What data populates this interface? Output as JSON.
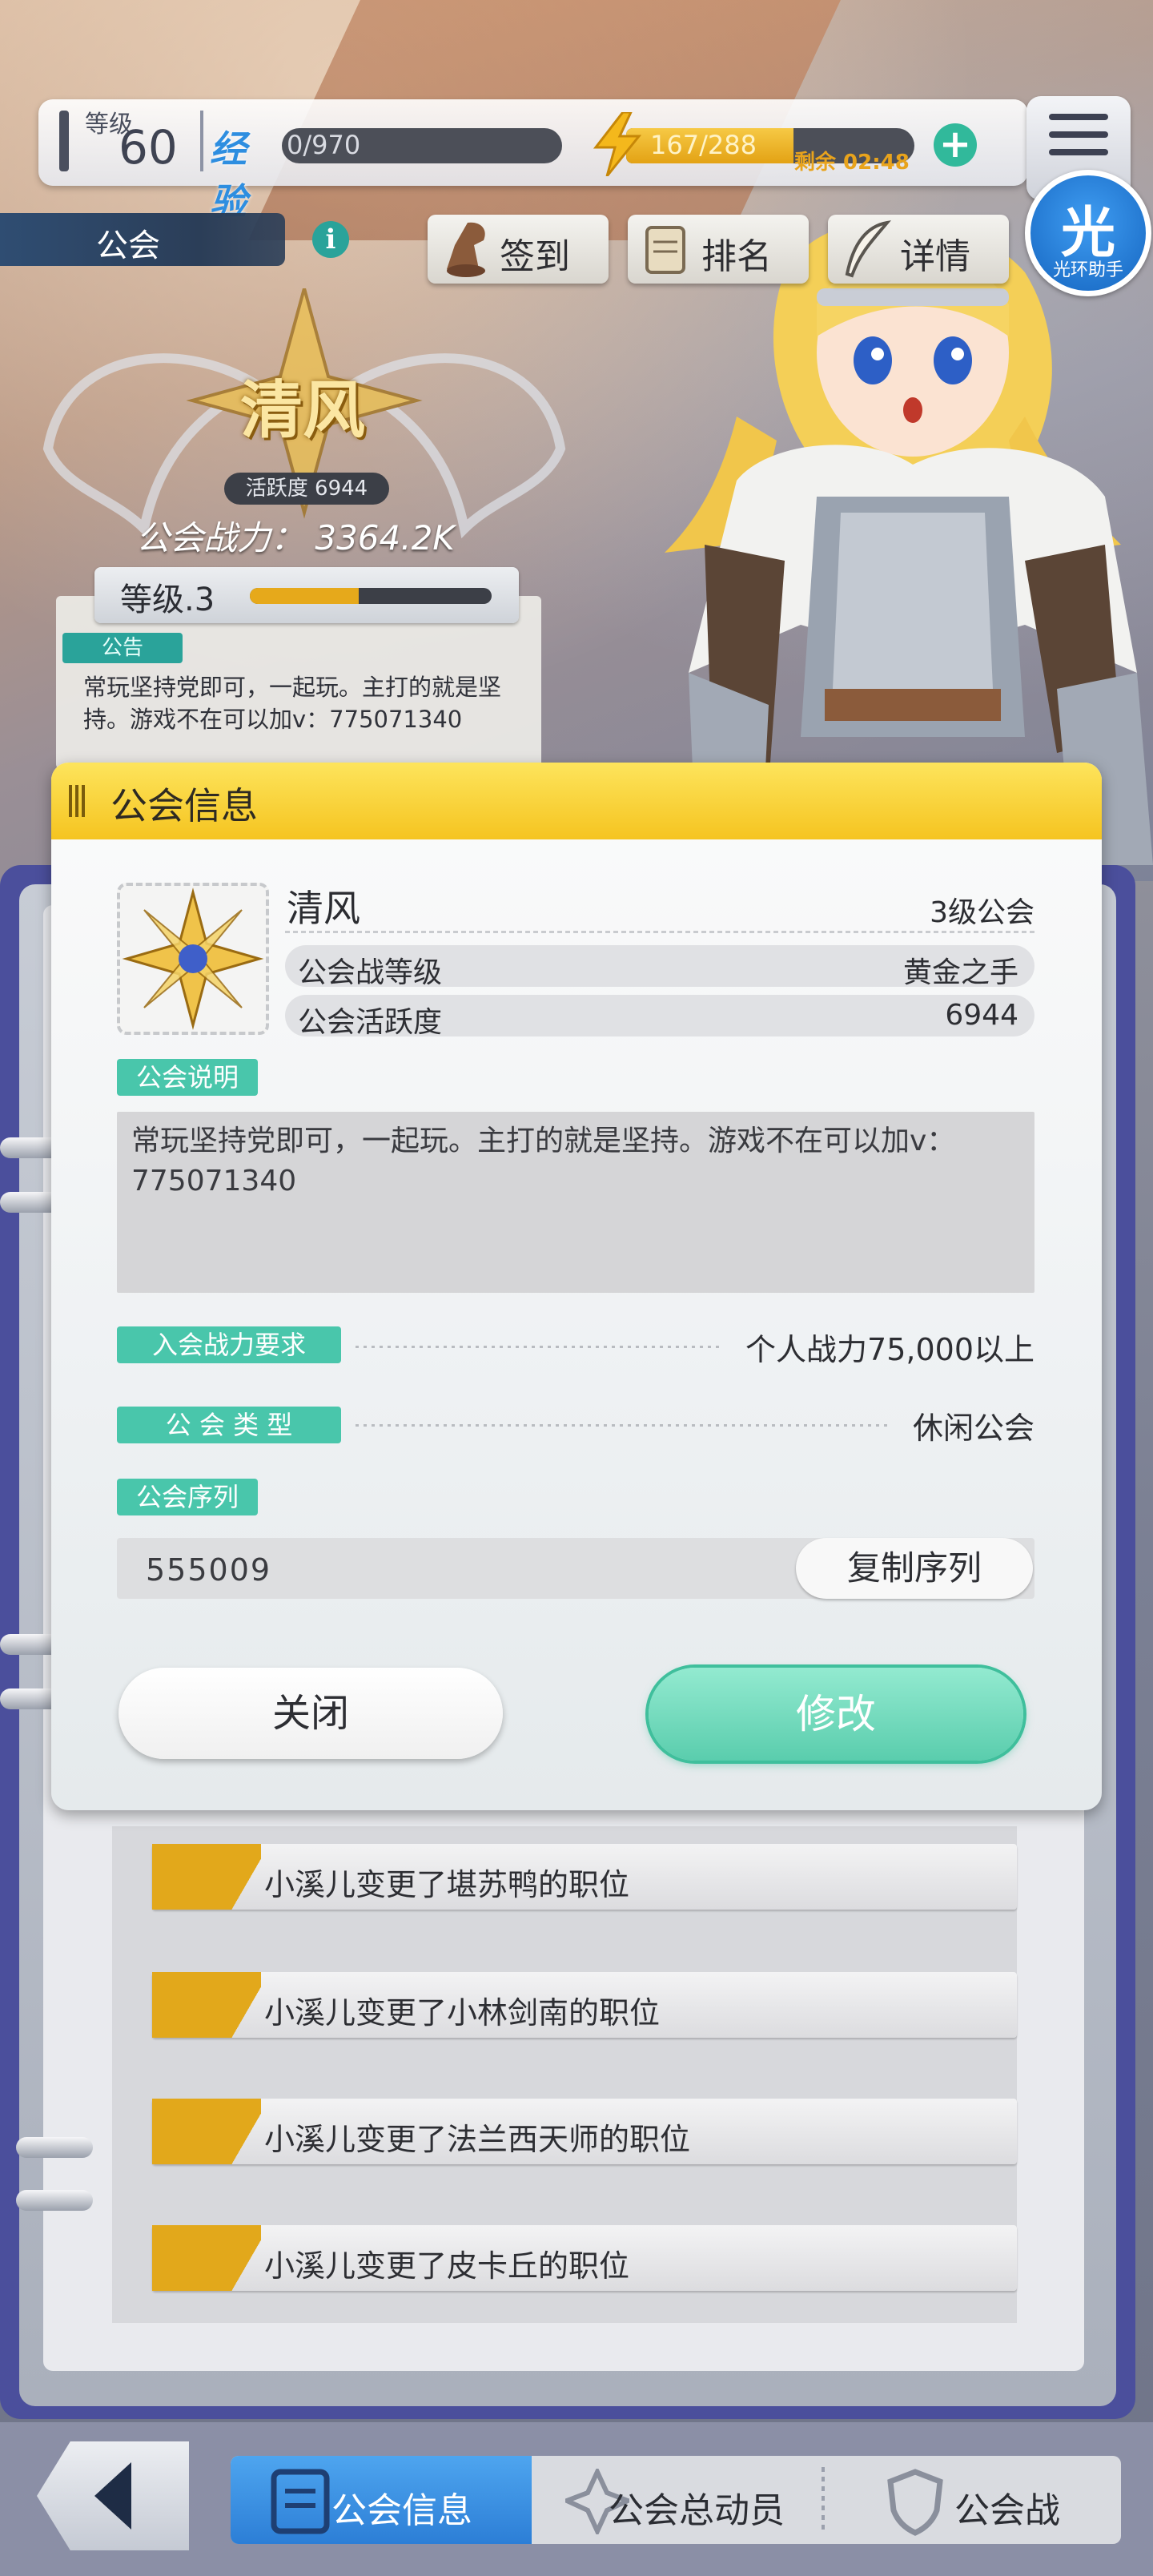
{
  "status_bar": {
    "level_label": "等级",
    "level_value": "60",
    "exp_label": "经验",
    "exp_value": "0/970",
    "energy_value": "167/288",
    "energy_fraction": 0.58,
    "remaining_time": "剩余 02:48",
    "plus_icon": "plus-icon",
    "menu_icon": "hamburger-menu-icon"
  },
  "overlay_badge": {
    "char": "光",
    "label": "光环助手"
  },
  "guild_header": {
    "strip_label": "公会",
    "info_icon": "i",
    "buttons": [
      {
        "label": "签到",
        "icon": "check-in-icon"
      },
      {
        "label": "排名",
        "icon": "scroll-icon"
      },
      {
        "label": "详情",
        "icon": "quill-icon"
      }
    ]
  },
  "guild_banner": {
    "name": "清风",
    "activity_label": "活跃度 6944",
    "power": "公会战力：  3364.2K",
    "level_label": "等级.3",
    "level_progress": 0.45,
    "notice_tag": "公告",
    "notice_text": "常玩坚持党即可，一起玩。主打的就是坚持。游戏不在可以加v：775071340"
  },
  "modal": {
    "title": "公会信息",
    "guild_name": "清风",
    "guild_level": "3级公会",
    "rows": [
      {
        "label": "公会战等级",
        "value": "黄金之手"
      },
      {
        "label": "公会活跃度",
        "value": "6944"
      }
    ],
    "desc_tag": "公会说明",
    "description": "常玩坚持党即可，一起玩。主打的就是坚持。游戏不在可以加v：775071340",
    "requirement_tag": "入会战力要求",
    "requirement_value": "个人战力75,000以上",
    "type_tag": "公 会 类 型",
    "type_value": "休闲公会",
    "serial_tag": "公会序列",
    "serial_value": "555009",
    "copy_button": "复制序列",
    "close_button": "关闭",
    "edit_button": "修改"
  },
  "log_items": [
    "小溪儿变更了堪苏鸭的职位",
    "小溪儿变更了小林剑南的职位",
    "小溪儿变更了法兰西天师的职位",
    "小溪儿变更了皮卡丘的职位"
  ],
  "bottom_nav": {
    "back_icon": "back-arrow-icon",
    "tabs": [
      {
        "label": "公会信息",
        "active": true
      },
      {
        "label": "公会总动员",
        "active": false
      },
      {
        "label": "公会战",
        "active": false
      }
    ]
  }
}
